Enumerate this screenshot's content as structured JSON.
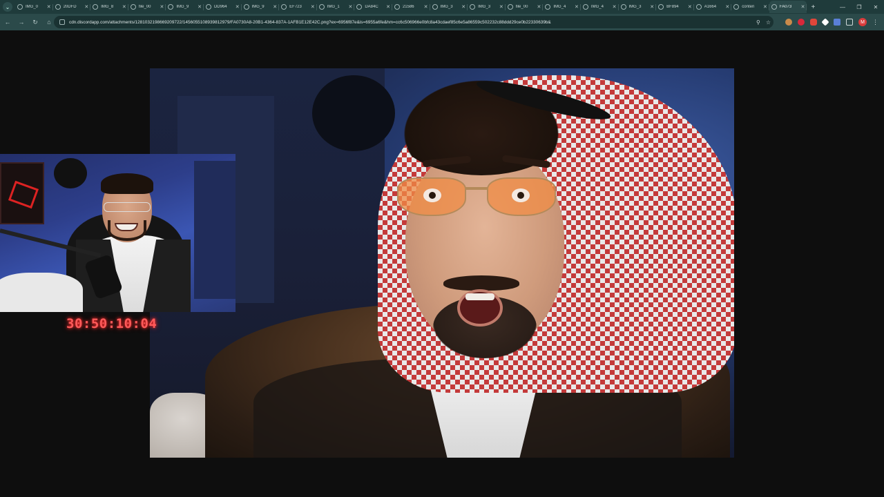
{
  "browser": {
    "tabs": [
      {
        "title": "IMG_0"
      },
      {
        "title": "20DFD"
      },
      {
        "title": "IMG_8"
      },
      {
        "title": "file_00"
      },
      {
        "title": "IMG_9"
      },
      {
        "title": "DD964"
      },
      {
        "title": "IMG_9"
      },
      {
        "title": "EF723"
      },
      {
        "title": "IMG_1"
      },
      {
        "title": "DA84C"
      },
      {
        "title": "21586"
      },
      {
        "title": "IMG_3"
      },
      {
        "title": "IMG_3"
      },
      {
        "title": "file_00"
      },
      {
        "title": "IMG_4"
      },
      {
        "title": "IMG_4"
      },
      {
        "title": "IMG_3"
      },
      {
        "title": "BF894"
      },
      {
        "title": "A1664"
      },
      {
        "title": "conten"
      },
      {
        "title": "FA073",
        "active": true
      }
    ],
    "url": "cdn.discordapp.com/attachments/1281032198669209722/1456055108939812979/FA0730A8-20B1-4364-837A-1AFB1E12E42C.png?ex=6956f87e&is=6955a6fe&hm=cc6c506966e0bfc8a43cdaef85c6e5a86559c502232c88ddd29ce0b22330639b&",
    "avatar_initial": "M",
    "accent": "#2b4a4a"
  },
  "overlay": {
    "timer": "30:50:10:04",
    "timer_color": "#ff5a5a"
  }
}
